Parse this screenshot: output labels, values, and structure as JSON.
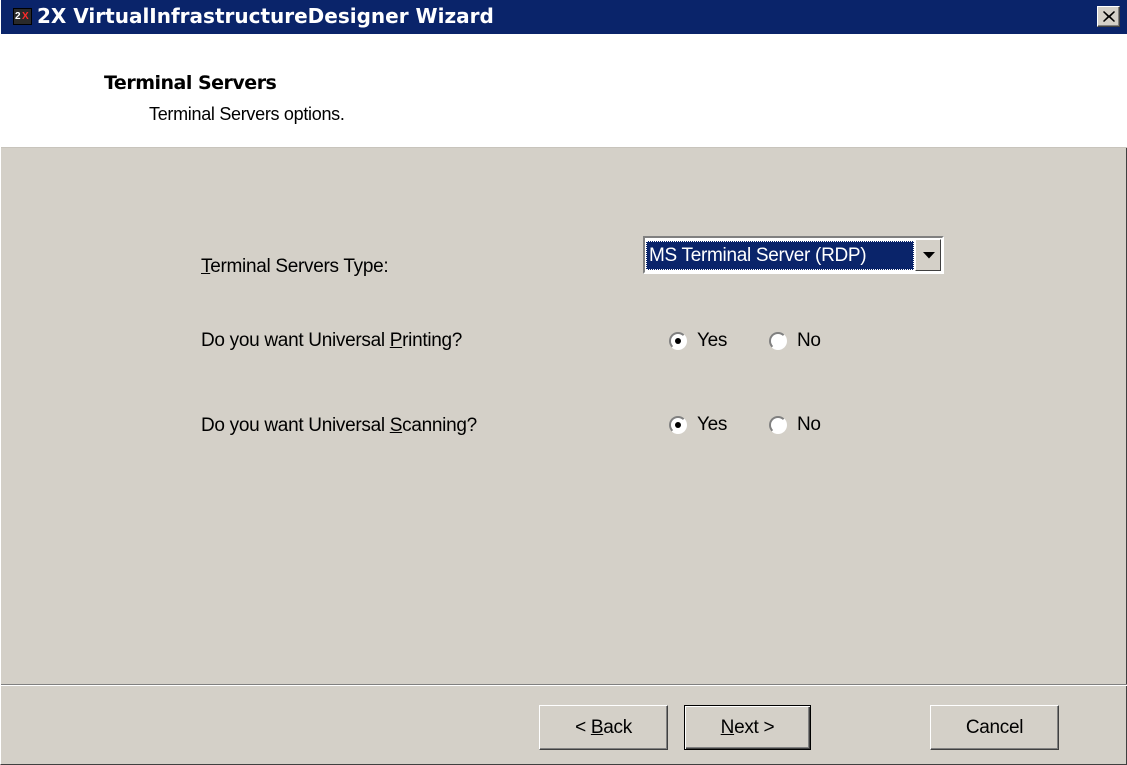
{
  "window": {
    "title": "2X VirtualInfrastructureDesigner Wizard",
    "app_icon_text_a": "2",
    "app_icon_text_b": "X",
    "titlebar_color": "#0a246a",
    "face_color": "#d4d0c8"
  },
  "header": {
    "title": "Terminal Servers",
    "subtitle": "Terminal Servers options."
  },
  "form": {
    "terminal_type": {
      "label_prefix": "",
      "label_mnemonic": "T",
      "label_suffix": "erminal Servers Type:",
      "value": "MS Terminal Server (RDP)"
    },
    "printing": {
      "label_prefix": "Do you want Universal ",
      "label_mnemonic": "P",
      "label_suffix": "rinting?",
      "selected": "Yes",
      "yes_label": "Yes",
      "no_label": "No"
    },
    "scanning": {
      "label_prefix": "Do you want Universal ",
      "label_mnemonic": "S",
      "label_suffix": "canning?",
      "selected": "Yes",
      "yes_label": "Yes",
      "no_label": "No"
    }
  },
  "buttons": {
    "back": {
      "prefix": "< ",
      "mnemonic": "B",
      "suffix": "ack"
    },
    "next": {
      "prefix": "",
      "mnemonic": "N",
      "suffix": "ext >"
    },
    "cancel": {
      "label": "Cancel"
    }
  },
  "icons": {
    "close": "close-icon",
    "dropdown": "chevron-down-icon",
    "app": "app-logo-icon"
  }
}
